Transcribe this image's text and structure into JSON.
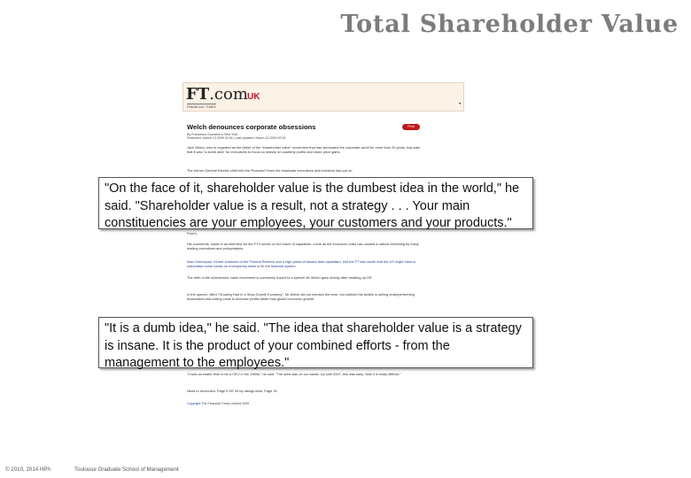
{
  "slide": {
    "title": "Total Shareholder Value"
  },
  "article": {
    "logo_ft": "FT",
    "logo_com": ".com",
    "logo_sub": "FINANCIAL TIMES",
    "edition": "UK",
    "arrow": "◂",
    "headline": "Welch denounces corporate obsessions",
    "print_label": "Print",
    "byline": "By Francesco Guerrera in New York",
    "published": "Published: March 13 2009 02:00 | Last updated: March 13 2009 02:00",
    "paragraphs": [
      "Jack Welch, who is regarded as the father of the \"shareholder value\" movement that has dominated the corporate world for more than 20 years, has said that it was \"a dumb idea\" for executives to focus so heavily on quarterly profits and share price gains.",
      "The former General Electric chief told the Financial Times the emphasis executives and investors had put on",
      "Poor's.",
      "His comments, made in an interview for the FT's series on the future of capitalism, come as the economic crisis has caused a radical rethinking by many leading executives and policymakers.",
      "Alan Greenspan, former chairman of the Federal Reserve and a high priest of laissez-faire capitalism, told the FT last month that the US might have to nationalise some banks on a temporary basis to fix the financial system.",
      "The birth of the shareholder value movement is commonly traced to a speech Mr Welch gave shortly after heading up GE.",
      "In the speech, titled \"Growing Fast in a Slow-Growth Economy\", Mr Welch did not mention the term, but outlined his beliefs in selling underperforming businesses and cutting costs to increase profits faster than global economic growth.",
      "\"It was an easier time to be a CEO in the 1980s,\" he said. \"The wind was on our backs. Up until 2007, this was easy. Now it is really difficult.\"",
      "Need to reconnect, Page 9  GE hit by ratings blow, Page 15"
    ],
    "copyright_link": "Copyright",
    "copyright_text": "The Financial Times Limited 2009"
  },
  "quotes": {
    "quote1": "\"On the face of it, shareholder value is the dumbest idea in the world,\" he said. \"Shareholder value is a result, not a strategy . . . Your main constituencies are your employees, your customers and your products.\"",
    "quote2": "\"It is a dumb idea,\" he said. \"The idea that shareholder value is a strategy is insane. It is the product of your combined efforts - from the management to the employees.\""
  },
  "footer": {
    "copyright": "© 2010, 2014 HPh",
    "school": "Toulouse Graduate School of Management"
  }
}
